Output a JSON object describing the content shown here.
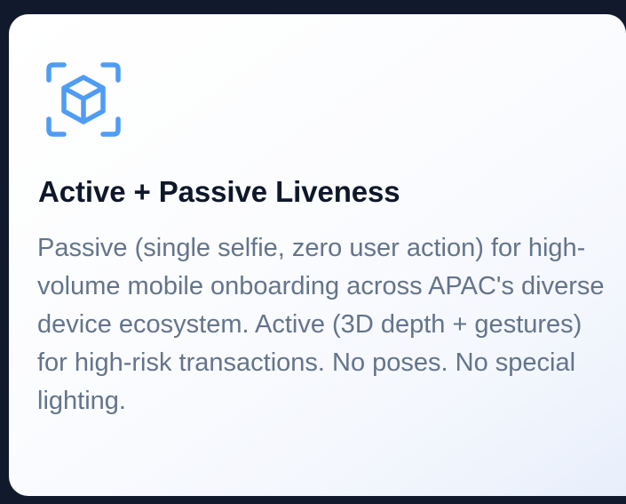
{
  "card": {
    "icon": "3d-cube-scan-icon",
    "accent_color": "#4f9cf5",
    "title": "Active + Passive Liveness",
    "description": "Passive (single selfie, zero user action) for high-volume mobile onboarding across APAC's diverse device ecosystem. Active (3D depth + gestures) for high-risk transactions. No poses. No special lighting."
  }
}
